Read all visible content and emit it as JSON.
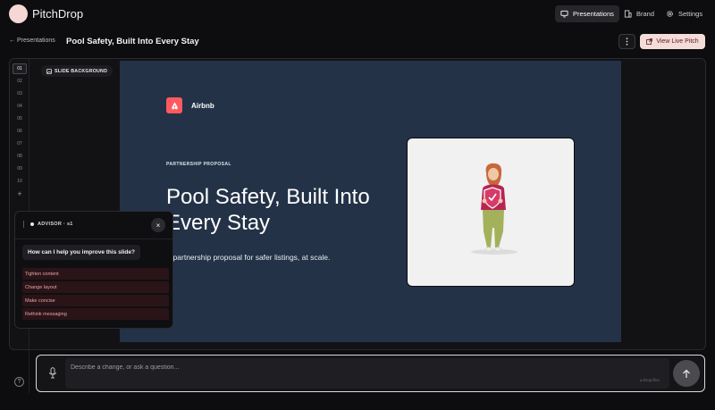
{
  "app": {
    "name": "PitchDrop"
  },
  "nav": {
    "presentations": "Presentations",
    "brand": "Brand",
    "settings": "Settings"
  },
  "header": {
    "back_label": "← Presentations",
    "deck_title": "Pool Safety, Built Into Every Stay",
    "more_icon": "more-vertical-icon",
    "live_button": "View Live Pitch"
  },
  "rail": {
    "slides": [
      "01",
      "02",
      "03",
      "04",
      "05",
      "06",
      "07",
      "08",
      "09",
      "10"
    ],
    "active_index": 0,
    "add_label": "+"
  },
  "slide_background_label": "SLIDE BACKGROUND",
  "slide": {
    "brand": "Airbnb",
    "eyebrow": "PARTNERSHIP PROPOSAL",
    "headline": "Pool Safety, Built Into Every Stay",
    "subline": "A partnership proposal for safer listings, at scale.",
    "background_color": "#233247",
    "brand_color": "#ff5a5f"
  },
  "advisor": {
    "title": "ADVISOR · s1",
    "close_label": "×",
    "question": "How can I help you improve this slide?",
    "options": [
      "Tighten content",
      "Change layout",
      "Make concise",
      "Rethink messaging"
    ]
  },
  "prompt": {
    "placeholder": "Describe a change, or ask a question...",
    "drop_hint": "⌀ Drop files",
    "send_icon": "arrow-up-icon"
  },
  "colors": {
    "accent": "#f4dcd8",
    "background": "#0d0d0f"
  }
}
